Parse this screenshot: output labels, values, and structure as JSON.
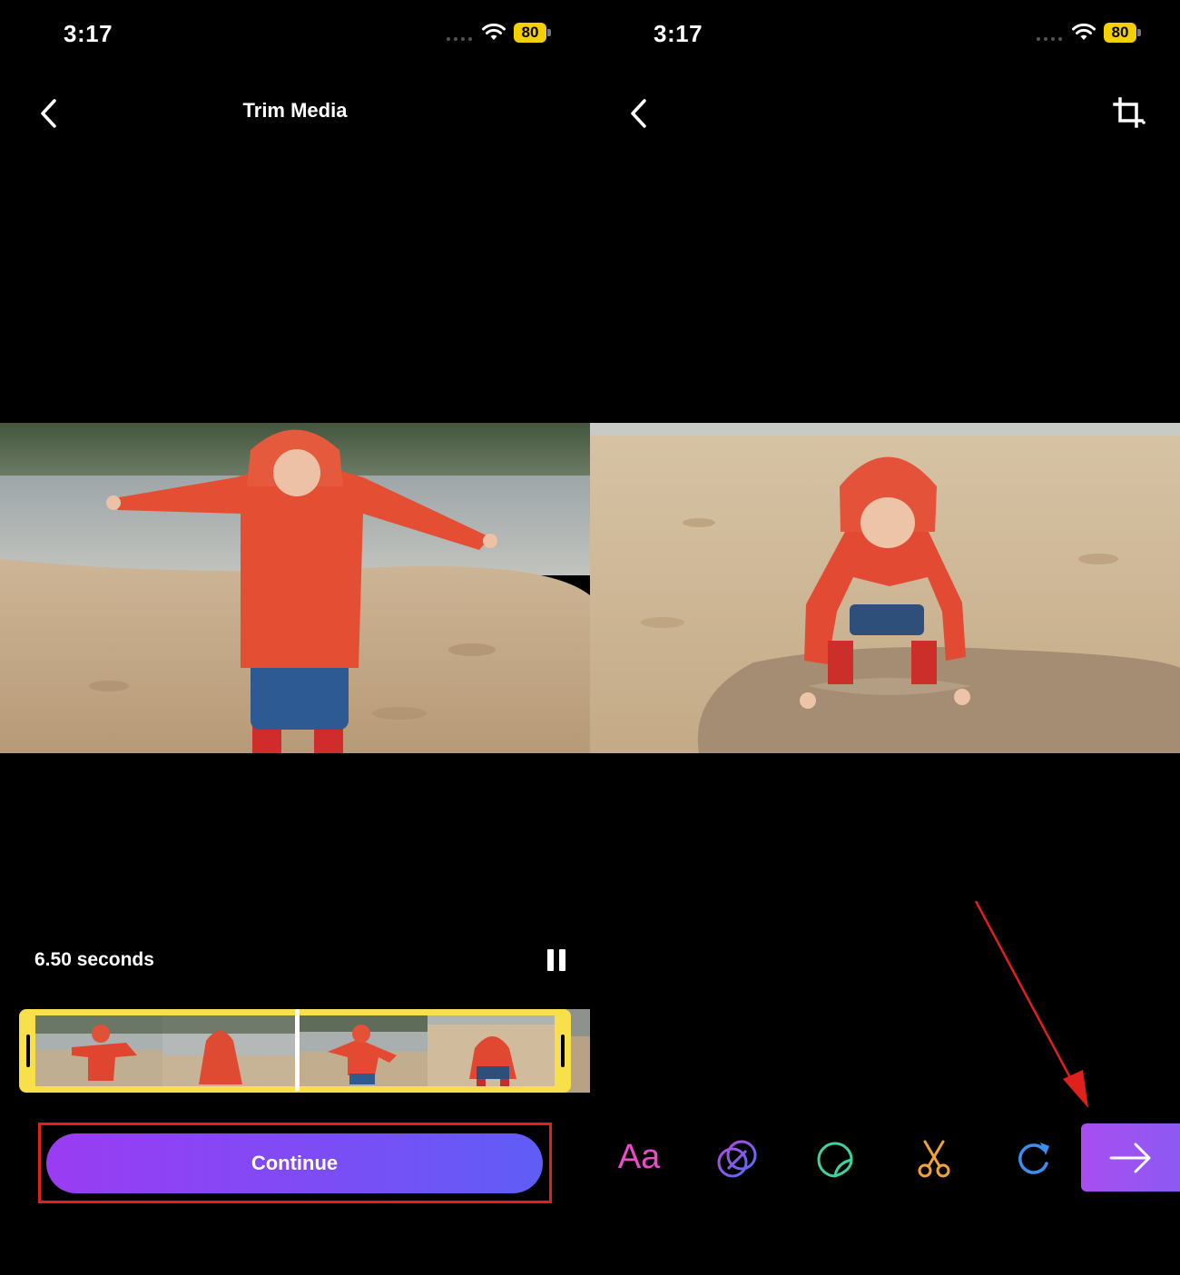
{
  "left_screen": {
    "status_bar": {
      "time": "3:17",
      "battery": "80"
    },
    "nav": {
      "title": "Trim Media"
    },
    "trim": {
      "duration": "6.50 seconds"
    },
    "continue_label": "Continue"
  },
  "right_screen": {
    "status_bar": {
      "time": "3:17",
      "battery": "80"
    },
    "toolbar": {
      "text_tool_label": "Aa"
    }
  },
  "icons": {
    "back": "chevron-left-icon",
    "pause": "pause-icon",
    "crop": "crop-icon",
    "text": "text-icon",
    "effects": "overlapping-circles-icon",
    "sticker": "sticker-icon",
    "cut": "scissors-icon",
    "redo": "redo-icon",
    "next": "arrow-right-icon"
  },
  "colors": {
    "trim_frame": "#f8e04a",
    "button_gradient_start": "#9a3cf2",
    "button_gradient_end": "#5f5df6",
    "highlight_annotation": "#e0201a",
    "battery_badge": "#f5d000"
  }
}
